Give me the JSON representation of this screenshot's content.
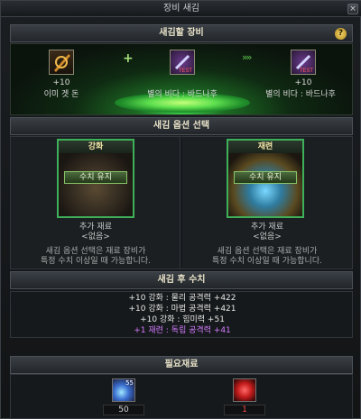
{
  "window": {
    "title": "장비 새김",
    "close_label": "×"
  },
  "equip_section": {
    "header": "새김할 장비",
    "help_label": "?",
    "slots": [
      {
        "level": "+10",
        "name": "이미 겟 돈",
        "icon": "weapon-icon"
      },
      {
        "level": "",
        "name": "별의 비다 : 바드나후",
        "icon": "test-item-icon"
      },
      {
        "level": "+10",
        "name": "별의 비다 : 바드나후",
        "icon": "test-item-icon"
      }
    ],
    "plus_symbol": "+",
    "arrow_symbol": "»»"
  },
  "option_section": {
    "header": "새김 옵션 선택",
    "options": [
      {
        "title": "강화",
        "keep_label": "수치 유지",
        "material_label": "추가 재료",
        "material_value": "<없음>",
        "note_line1": "새김 옵션 선택은 재료 장비가",
        "note_line2": "특정 수치 이상일 때 가능합니다."
      },
      {
        "title": "재련",
        "keep_label": "수치 유지",
        "material_label": "추가 재료",
        "material_value": "<없음>",
        "note_line1": "새김 옵션 선택은 재료 장비가",
        "note_line2": "특정 수치 이상일 때 가능합니다."
      }
    ]
  },
  "after_section": {
    "header": "새김 후 수치",
    "lines": [
      "+10 강화 : 물리 공격력 +422",
      "+10 강화 : 마법 공격력 +421",
      "+10 강화 : 힘미력 +51",
      "+1 재련 : 독립 공격력 +41"
    ]
  },
  "material_section": {
    "header": "필요재료",
    "items": [
      {
        "icon": "blue-crystal-icon",
        "badge": "55",
        "count": "50"
      },
      {
        "icon": "red-gem-icon",
        "badge": "",
        "count": "1"
      }
    ]
  },
  "colors": {
    "accent_green": "#3fb05a",
    "purple_text": "#d47bff",
    "warning_red": "#ff4a4a"
  }
}
